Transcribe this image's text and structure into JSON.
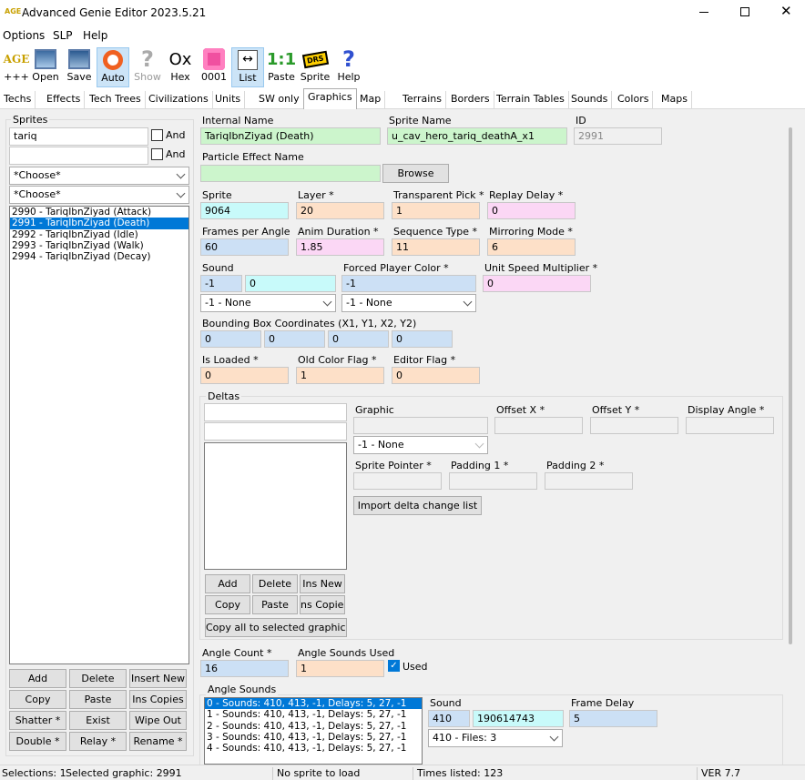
{
  "window": {
    "title": "Advanced Genie Editor 2023.5.21",
    "icon": "AGE"
  },
  "menu": [
    "Options",
    "SLP",
    "Help"
  ],
  "toolbar": [
    {
      "label": "+++",
      "icon": "age-logo-icon",
      "extra": "AGE"
    },
    {
      "label": "Open",
      "icon": "open-icon"
    },
    {
      "label": "Save",
      "icon": "save-icon"
    },
    {
      "label": "Auto",
      "icon": "lifebuoy-icon"
    },
    {
      "label": "Show",
      "icon": "question-icon"
    },
    {
      "label": "Hex",
      "icon": "hex-icon",
      "extra": "Ox"
    },
    {
      "label": "0001",
      "icon": "swirl-icon"
    },
    {
      "label": "List",
      "icon": "list-icon"
    },
    {
      "label": "Paste",
      "icon": "paste-icon",
      "extra": "1:1"
    },
    {
      "label": "Sprite",
      "icon": "drs-icon",
      "extra": "DRS"
    },
    {
      "label": "Help",
      "icon": "help-icon",
      "extra": "?"
    }
  ],
  "tabs": [
    "Techs",
    "Effects",
    "Tech Trees",
    "Civilizations",
    "Units",
    "SW only",
    "Graphics",
    "Map",
    "Terrains",
    "Borders",
    "Terrain Tables",
    "Sounds",
    "Colors",
    "Maps"
  ],
  "active_tab": "Graphics",
  "sprites": {
    "title": "Sprites",
    "search": "tariq",
    "search2": "",
    "and_label": "And",
    "choose": "*Choose*",
    "items": [
      "2990 - TariqIbnZiyad (Attack)",
      "2991 - TariqIbnZiyad (Death)",
      "2992 - TariqIbnZiyad (Idle)",
      "2993 - TariqIbnZiyad (Walk)",
      "2994 - TariqIbnZiyad (Decay)"
    ],
    "selected": 1,
    "buttons": [
      "Add",
      "Delete",
      "Insert New",
      "Copy",
      "Paste",
      "Ins Copies",
      "Shatter *",
      "Exist",
      "Wipe Out",
      "Double *",
      "Relay *",
      "Rename *"
    ]
  },
  "main": {
    "internal_name": {
      "label": "Internal Name",
      "value": "TariqIbnZiyad (Death)"
    },
    "sprite_name": {
      "label": "Sprite Name",
      "value": "u_cav_hero_tariq_deathA_x1"
    },
    "id": {
      "label": "ID",
      "value": "2991"
    },
    "particle": {
      "label": "Particle Effect Name",
      "value": "",
      "button": "Browse"
    },
    "sprite": {
      "label": "Sprite",
      "value": "9064"
    },
    "layer": {
      "label": "Layer *",
      "value": "20"
    },
    "transparent_pick": {
      "label": "Transparent Pick *",
      "value": "1"
    },
    "replay_delay": {
      "label": "Replay Delay *",
      "value": "0"
    },
    "frames_per_angle": {
      "label": "Frames per Angle",
      "value": "60"
    },
    "anim_duration": {
      "label": "Anim Duration *",
      "value": "1.85"
    },
    "sequence_type": {
      "label": "Sequence Type *",
      "value": "11"
    },
    "mirroring_mode": {
      "label": "Mirroring Mode *",
      "value": "6"
    },
    "sound": {
      "label": "Sound",
      "value1": "-1",
      "value2": "0",
      "combo": "-1 - None"
    },
    "forced_player_color": {
      "label": "Forced Player Color *",
      "value": "-1",
      "combo": "-1 - None"
    },
    "unit_speed_multiplier": {
      "label": "Unit Speed Multiplier *",
      "value": "0"
    },
    "bbox": {
      "label": "Bounding Box Coordinates (X1, Y1, X2, Y2)",
      "values": [
        "0",
        "0",
        "0",
        "0"
      ]
    },
    "is_loaded": {
      "label": "Is Loaded *",
      "value": "0"
    },
    "old_color_flag": {
      "label": "Old Color Flag *",
      "value": "1"
    },
    "editor_flag": {
      "label": "Editor Flag *",
      "value": "0"
    },
    "deltas": {
      "title": "Deltas",
      "graphic": "Graphic",
      "offset_x": "Offset X *",
      "offset_y": "Offset Y *",
      "display_angle": "Display Angle *",
      "combo": "-1 - None",
      "sprite_pointer": "Sprite Pointer *",
      "padding1": "Padding 1 *",
      "padding2": "Padding 2 *",
      "import": "Import delta change list",
      "buttons": [
        "Add",
        "Delete",
        "Ins New",
        "Copy",
        "Paste",
        "ns Copies"
      ],
      "copy_all": "Copy all to selected graphics"
    },
    "angle_count": {
      "label": "Angle Count *",
      "value": "16"
    },
    "angle_sounds_used": {
      "label": "Angle Sounds Used",
      "value": "1",
      "check": "Used"
    },
    "angle_sounds": {
      "title": "Angle Sounds",
      "items": [
        "0 - Sounds: 410, 413, -1, Delays: 5, 27, -1",
        "1 - Sounds: 410, 413, -1, Delays: 5, 27, -1",
        "2 - Sounds: 410, 413, -1, Delays: 5, 27, -1",
        "3 - Sounds: 410, 413, -1, Delays: 5, 27, -1",
        "4 - Sounds: 410, 413, -1, Delays: 5, 27, -1"
      ],
      "sound_label": "Sound",
      "sound1": "410",
      "sound2": "190614743",
      "combo": "410 - Files: 3",
      "frame_delay_label": "Frame Delay",
      "frame_delay": "5"
    }
  },
  "status": {
    "selections": "Selections: 1",
    "selected": "Selected graphic: 2991",
    "sprite": "No sprite to load",
    "times": "Times listed: 123",
    "ver": "VER 7.7"
  }
}
